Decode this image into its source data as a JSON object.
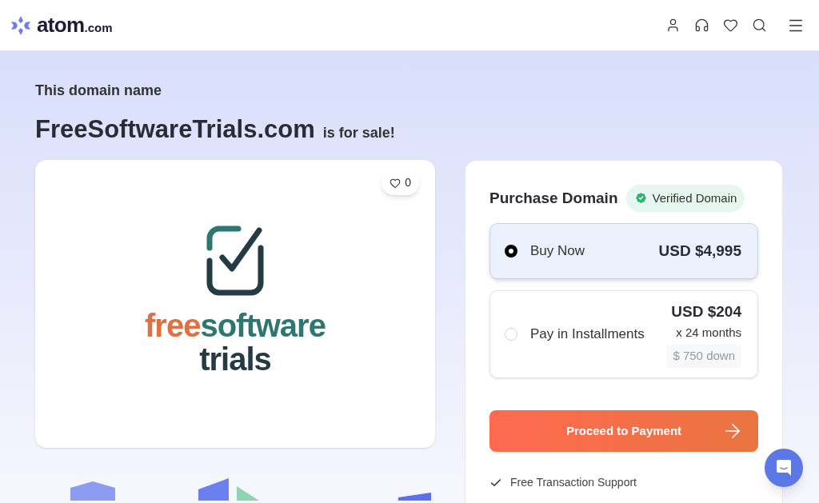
{
  "header": {
    "brand": "atom",
    "brand_suffix": ".com"
  },
  "intro": {
    "eyebrow": "This domain name",
    "domain": "FreeSoftwareTrials.com",
    "suffix": "is for sale!"
  },
  "preview": {
    "likes": "0",
    "logo_parts": [
      {
        "text": "free",
        "color": "#e0703f"
      },
      {
        "text": "software",
        "color": "#2e7770"
      }
    ],
    "logo_line2": "trials"
  },
  "purchase": {
    "title": "Purchase Domain",
    "badge": "Verified Domain",
    "options": [
      {
        "label": "Buy Now",
        "price": "USD $4,995",
        "selected": true
      },
      {
        "label": "Pay in Installments",
        "price": "USD $204",
        "term": "x 24 months",
        "down": "$ 750 down",
        "selected": false
      }
    ],
    "cta": "Proceed to Payment",
    "features": [
      "Free Transaction Support"
    ]
  }
}
